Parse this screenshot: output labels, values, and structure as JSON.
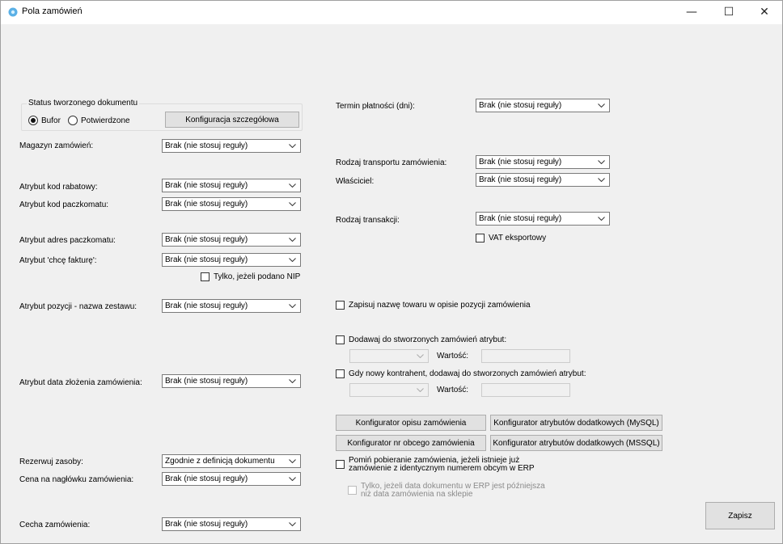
{
  "window": {
    "title": "Pola zamówień",
    "controls": {
      "minimize": "—",
      "maximize": "☐",
      "close": "✕"
    }
  },
  "status_group": {
    "title": "Status tworzonego dokumentu",
    "options": [
      "Bufor",
      "Potwierdzone"
    ],
    "selected": "Bufor",
    "config_button": "Konfiguracja szczegółowa"
  },
  "left": {
    "magazyn": {
      "label": "Magazyn zamówień:",
      "value": "Brak (nie stosuj reguły)"
    },
    "kod_rabatowy": {
      "label": "Atrybut kod rabatowy:",
      "value": "Brak (nie stosuj reguły)"
    },
    "kod_paczkomatu": {
      "label": "Atrybut kod paczkomatu:",
      "value": "Brak (nie stosuj reguły)"
    },
    "adres_paczkomatu": {
      "label": "Atrybut adres paczkomatu:",
      "value": "Brak (nie stosuj reguły)"
    },
    "chce_fakture": {
      "label": "Atrybut 'chcę fakturę':",
      "value": "Brak (nie stosuj reguły)"
    },
    "tylko_nip": {
      "label": "Tylko, jeżeli podano NIP",
      "checked": false
    },
    "nazwa_zestawu": {
      "label": "Atrybut pozycji - nazwa zestawu:",
      "value": "Brak (nie stosuj reguły)"
    },
    "data_zlozenia": {
      "label": "Atrybut data złożenia zamówienia:",
      "value": "Brak (nie stosuj reguły)"
    },
    "rezerwuj": {
      "label": "Rezerwuj zasoby:",
      "value": "Zgodnie z definicją dokumentu"
    },
    "cena_naglowek": {
      "label": "Cena na nagłówku zamówienia:",
      "value": "Brak (nie stosuj reguły)"
    },
    "cecha": {
      "label": "Cecha zamówienia:",
      "value": "Brak (nie stosuj reguły)"
    }
  },
  "right": {
    "termin": {
      "label": "Termin płatności (dni):",
      "value": "Brak (nie stosuj reguły)"
    },
    "transport": {
      "label": "Rodzaj transportu zamówienia:",
      "value": "Brak (nie stosuj reguły)"
    },
    "wlasciciel": {
      "label": "Właściciel:",
      "value": "Brak (nie stosuj reguły)"
    },
    "transakcja": {
      "label": "Rodzaj transakcji:",
      "value": "Brak (nie stosuj reguły)"
    },
    "vat_eksport": {
      "label": "VAT eksportowy",
      "checked": false
    },
    "zapisuj_nazwe": {
      "label": "Zapisuj nazwę towaru w opisie pozycji zamówienia",
      "checked": false
    },
    "dodawaj_atrybut": {
      "label": "Dodawaj do stworzonych zamówień atrybut:",
      "checked": false,
      "value_label": "Wartość:"
    },
    "nowy_kontrahent": {
      "label": "Gdy nowy kontrahent, dodawaj do stworzonych zamówień atrybut:",
      "checked": false,
      "value_label": "Wartość:"
    },
    "buttons": {
      "opis": "Konfigurator opisu zamówienia",
      "atr_mysql": "Konfigurator atrybutów dodatkowych (MySQL)",
      "nr_obcy": "Konfigurator nr obcego zamówienia",
      "atr_mssql": "Konfigurator atrybutów dodatkowych (MSSQL)"
    },
    "pomin": {
      "line1": "Pomiń pobieranie zamówienia, jeżeli istnieje już",
      "line2": "zamówienie z identycznym numerem obcym w ERP",
      "checked": false
    },
    "tylko_data": {
      "line1": "Tylko, jeżeli data dokumentu w ERP jest późniejsza",
      "line2": "niż data zamówienia na sklepie",
      "checked": false,
      "enabled": false
    }
  },
  "footer": {
    "save": "Zapisz"
  }
}
